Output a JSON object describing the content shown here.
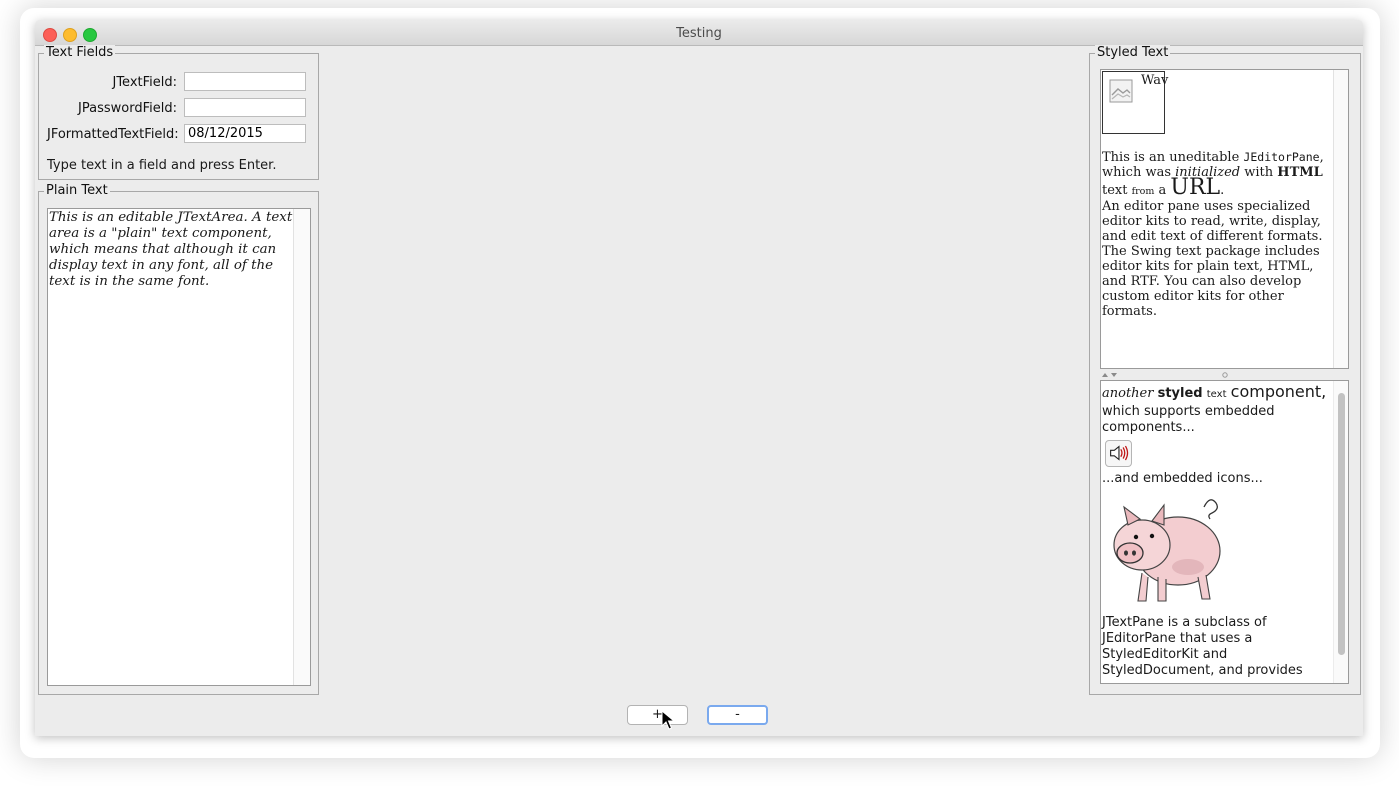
{
  "window": {
    "title": "Testing"
  },
  "text_fields": {
    "title": "Text Fields",
    "jtextfield_label": "JTextField:",
    "jtextfield_value": "",
    "jpasswordfield_label": "JPasswordField:",
    "jpasswordfield_value": "",
    "jformattedtextfield_label": "JFormattedTextField:",
    "jformattedtextfield_value": "08/12/2015",
    "hint": "Type text in a field and press Enter."
  },
  "plain_text": {
    "title": "Plain Text",
    "body": "This is an editable JTextArea. A text area is a \"plain\" text component, which means that although it can display text in any font, all of the text is in the same font."
  },
  "styled_text": {
    "title": "Styled Text",
    "editor": {
      "image_alt": "Wav",
      "p1_a": "This is an uneditable ",
      "p1_code": "JEditorPane",
      "p1_b": ", which was ",
      "p1_italic": "initialized",
      "p1_c": " with ",
      "p1_bold": "HTML",
      "p1_d": " text ",
      "p1_small": "from",
      "p1_e": " a ",
      "p1_big": "URL",
      "p1_f": ".",
      "p2": "An editor pane uses specialized editor kits to read, write, display, and edit text of different formats. The Swing text package includes editor kits for plain text, HTML, and RTF. You can also develop custom editor kits for other formats."
    },
    "textpane": {
      "line_a_italic": "another",
      "line_a_bold": "styled",
      "line_a_small": "text",
      "line_a_large": "component,",
      "line_b": "which supports embedded components...",
      "speaker_icon": "speaker-icon",
      "line_c": "...and embedded icons...",
      "pig_icon": "pig-icon",
      "line_d": "JTextPane is a subclass of JEditorPane that uses a StyledEditorKit and StyledDocument, and provides"
    }
  },
  "buttons": {
    "plus": "+",
    "minus": "-"
  }
}
